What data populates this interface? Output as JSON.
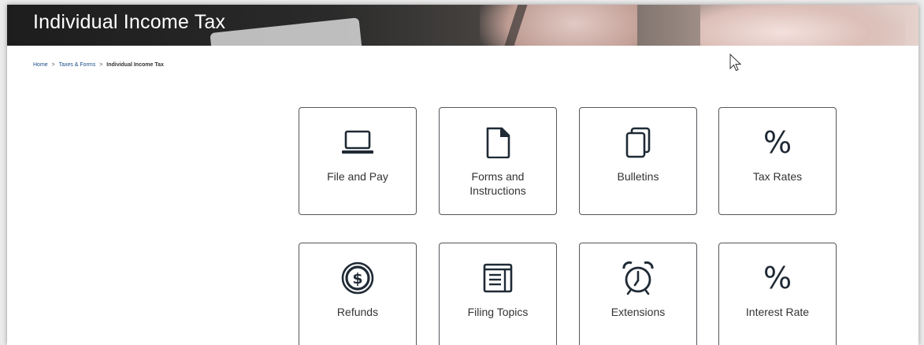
{
  "page": {
    "title": "Individual Income Tax"
  },
  "breadcrumb": {
    "home": "Home",
    "taxes_forms": "Taxes & Forms",
    "current": "Individual Income Tax",
    "separator": ">"
  },
  "tiles": [
    {
      "label_line1": "File and Pay",
      "label_line2": "",
      "icon": "laptop-icon"
    },
    {
      "label_line1": "Forms and",
      "label_line2": "Instructions",
      "icon": "document-icon"
    },
    {
      "label_line1": "Bulletins",
      "label_line2": "",
      "icon": "stacked-documents-icon"
    },
    {
      "label_line1": "Tax Rates",
      "label_line2": "",
      "icon": "percent-icon"
    },
    {
      "label_line1": "Refunds",
      "label_line2": "",
      "icon": "dollar-coin-icon"
    },
    {
      "label_line1": "Filing Topics",
      "label_line2": "",
      "icon": "newspaper-icon"
    },
    {
      "label_line1": "Extensions",
      "label_line2": "",
      "icon": "alarm-clock-icon"
    },
    {
      "label_line1": "Interest Rate",
      "label_line2": "",
      "icon": "percent-icon"
    }
  ],
  "icons": {
    "percent_glyph": "%"
  },
  "colors": {
    "link": "#1a4c8b",
    "tile_border": "#53565a",
    "icon": "#1f2a35",
    "text": "#333333"
  }
}
